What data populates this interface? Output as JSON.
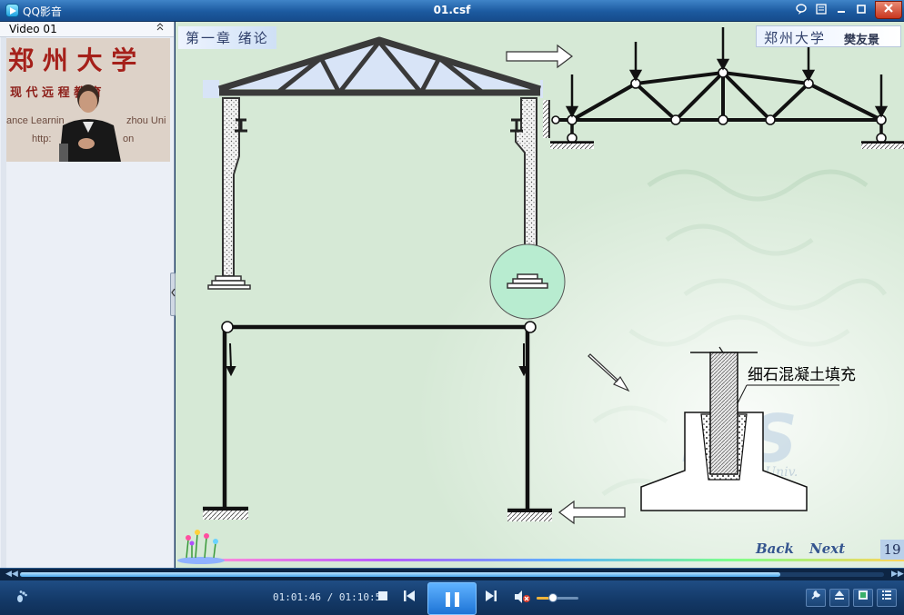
{
  "window": {
    "app_name": "QQ影音",
    "file_name": "01.csf",
    "icons": [
      "skin-icon",
      "menu-icon",
      "minimize-icon",
      "maximize-icon",
      "close-icon"
    ]
  },
  "playlist": {
    "title": "Video 01",
    "thumbnail": {
      "sign_line1": "郑 州 大 学",
      "sign_line2": "现 代 远 程 教 育",
      "sign_line3": "ance Learnin",
      "sign_line3b": "zhou Uni",
      "sign_line4": "http:",
      "sign_line4b": "on"
    }
  },
  "slide": {
    "chapter_title": "第一章  绪论",
    "university": "郑州大学",
    "author": "樊友景",
    "fill_label": "细石混凝土填充",
    "watermark_letters": "ITS",
    "watermark_sub": "zhou Univ.",
    "back_label": "Back",
    "next_label": "Next",
    "page_number": "19",
    "accent_colors": {
      "steel": "#3a3a3a",
      "node_circle": "#b8ecd0",
      "roof_glass": "#d8e2ff"
    }
  },
  "player": {
    "progress_fraction": 0.88,
    "time_current": "01:01:46",
    "time_total": "01:10:51",
    "volume_fraction": 0.4,
    "volume_muted": true,
    "right_buttons": [
      "wrench-icon",
      "eject-icon",
      "screen-icon",
      "playlist-icon"
    ]
  }
}
